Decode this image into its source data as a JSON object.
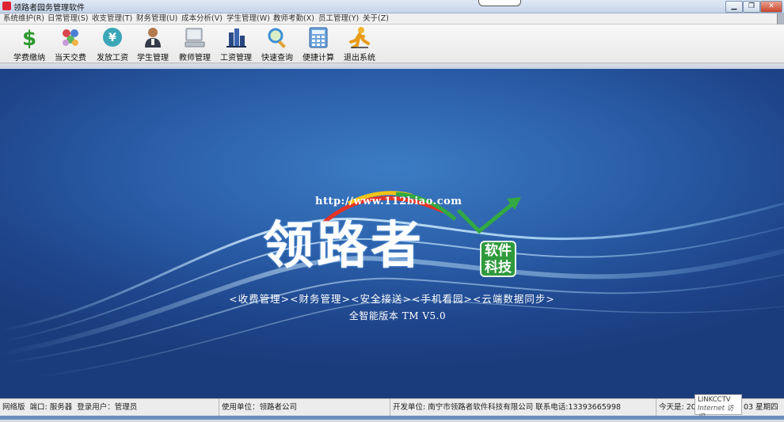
{
  "window": {
    "title": "领路者园务管理软件",
    "minimize_label": "▁",
    "restore_label": "❐",
    "close_label": "✕"
  },
  "menu": [
    {
      "label": "系统维护(R)"
    },
    {
      "label": "日常管理(S)"
    },
    {
      "label": "收支管理(T)"
    },
    {
      "label": "财务管理(U)"
    },
    {
      "label": "成本分析(V)"
    },
    {
      "label": "学生管理(W)"
    },
    {
      "label": "教师考勤(X)"
    },
    {
      "label": "员工管理(Y)"
    },
    {
      "label": "关于(Z)"
    }
  ],
  "toolbar": [
    {
      "label": "学费缴纳",
      "icon": "dollar-icon"
    },
    {
      "label": "当天交费",
      "icon": "people-icon"
    },
    {
      "label": "发放工资",
      "icon": "yen-icon"
    },
    {
      "label": "学生管理",
      "icon": "person-icon"
    },
    {
      "label": "教师管理",
      "icon": "computer-icon"
    },
    {
      "label": "工资管理",
      "icon": "buildings-icon"
    },
    {
      "label": "快速查询",
      "icon": "magnifier-icon"
    },
    {
      "label": "便捷计算",
      "icon": "calculator-icon"
    },
    {
      "label": "退出系统",
      "icon": "running-man-icon"
    }
  ],
  "splash": {
    "url": "http://www.112biao.com",
    "logo_text": "领路者",
    "badge_line1": "软件",
    "badge_line2": "科技",
    "features": "<收费管理><财务管理><安全接送><手机看园><云端数据同步>",
    "version": "全智能版本 TM V5.0"
  },
  "status": {
    "network": "网络版",
    "port": "端口: 服务器",
    "user": "登录用户：管理员",
    "unit": "使用单位：领路者公司",
    "developer": "开发单位: 南宁市领路者软件科技有限公司 联系电话:13393665998",
    "today": "今天是: 201",
    "date_tail": "03 星期四"
  },
  "overlay": {
    "line1": "LINKCCTV",
    "line2": "Internet 访问"
  }
}
